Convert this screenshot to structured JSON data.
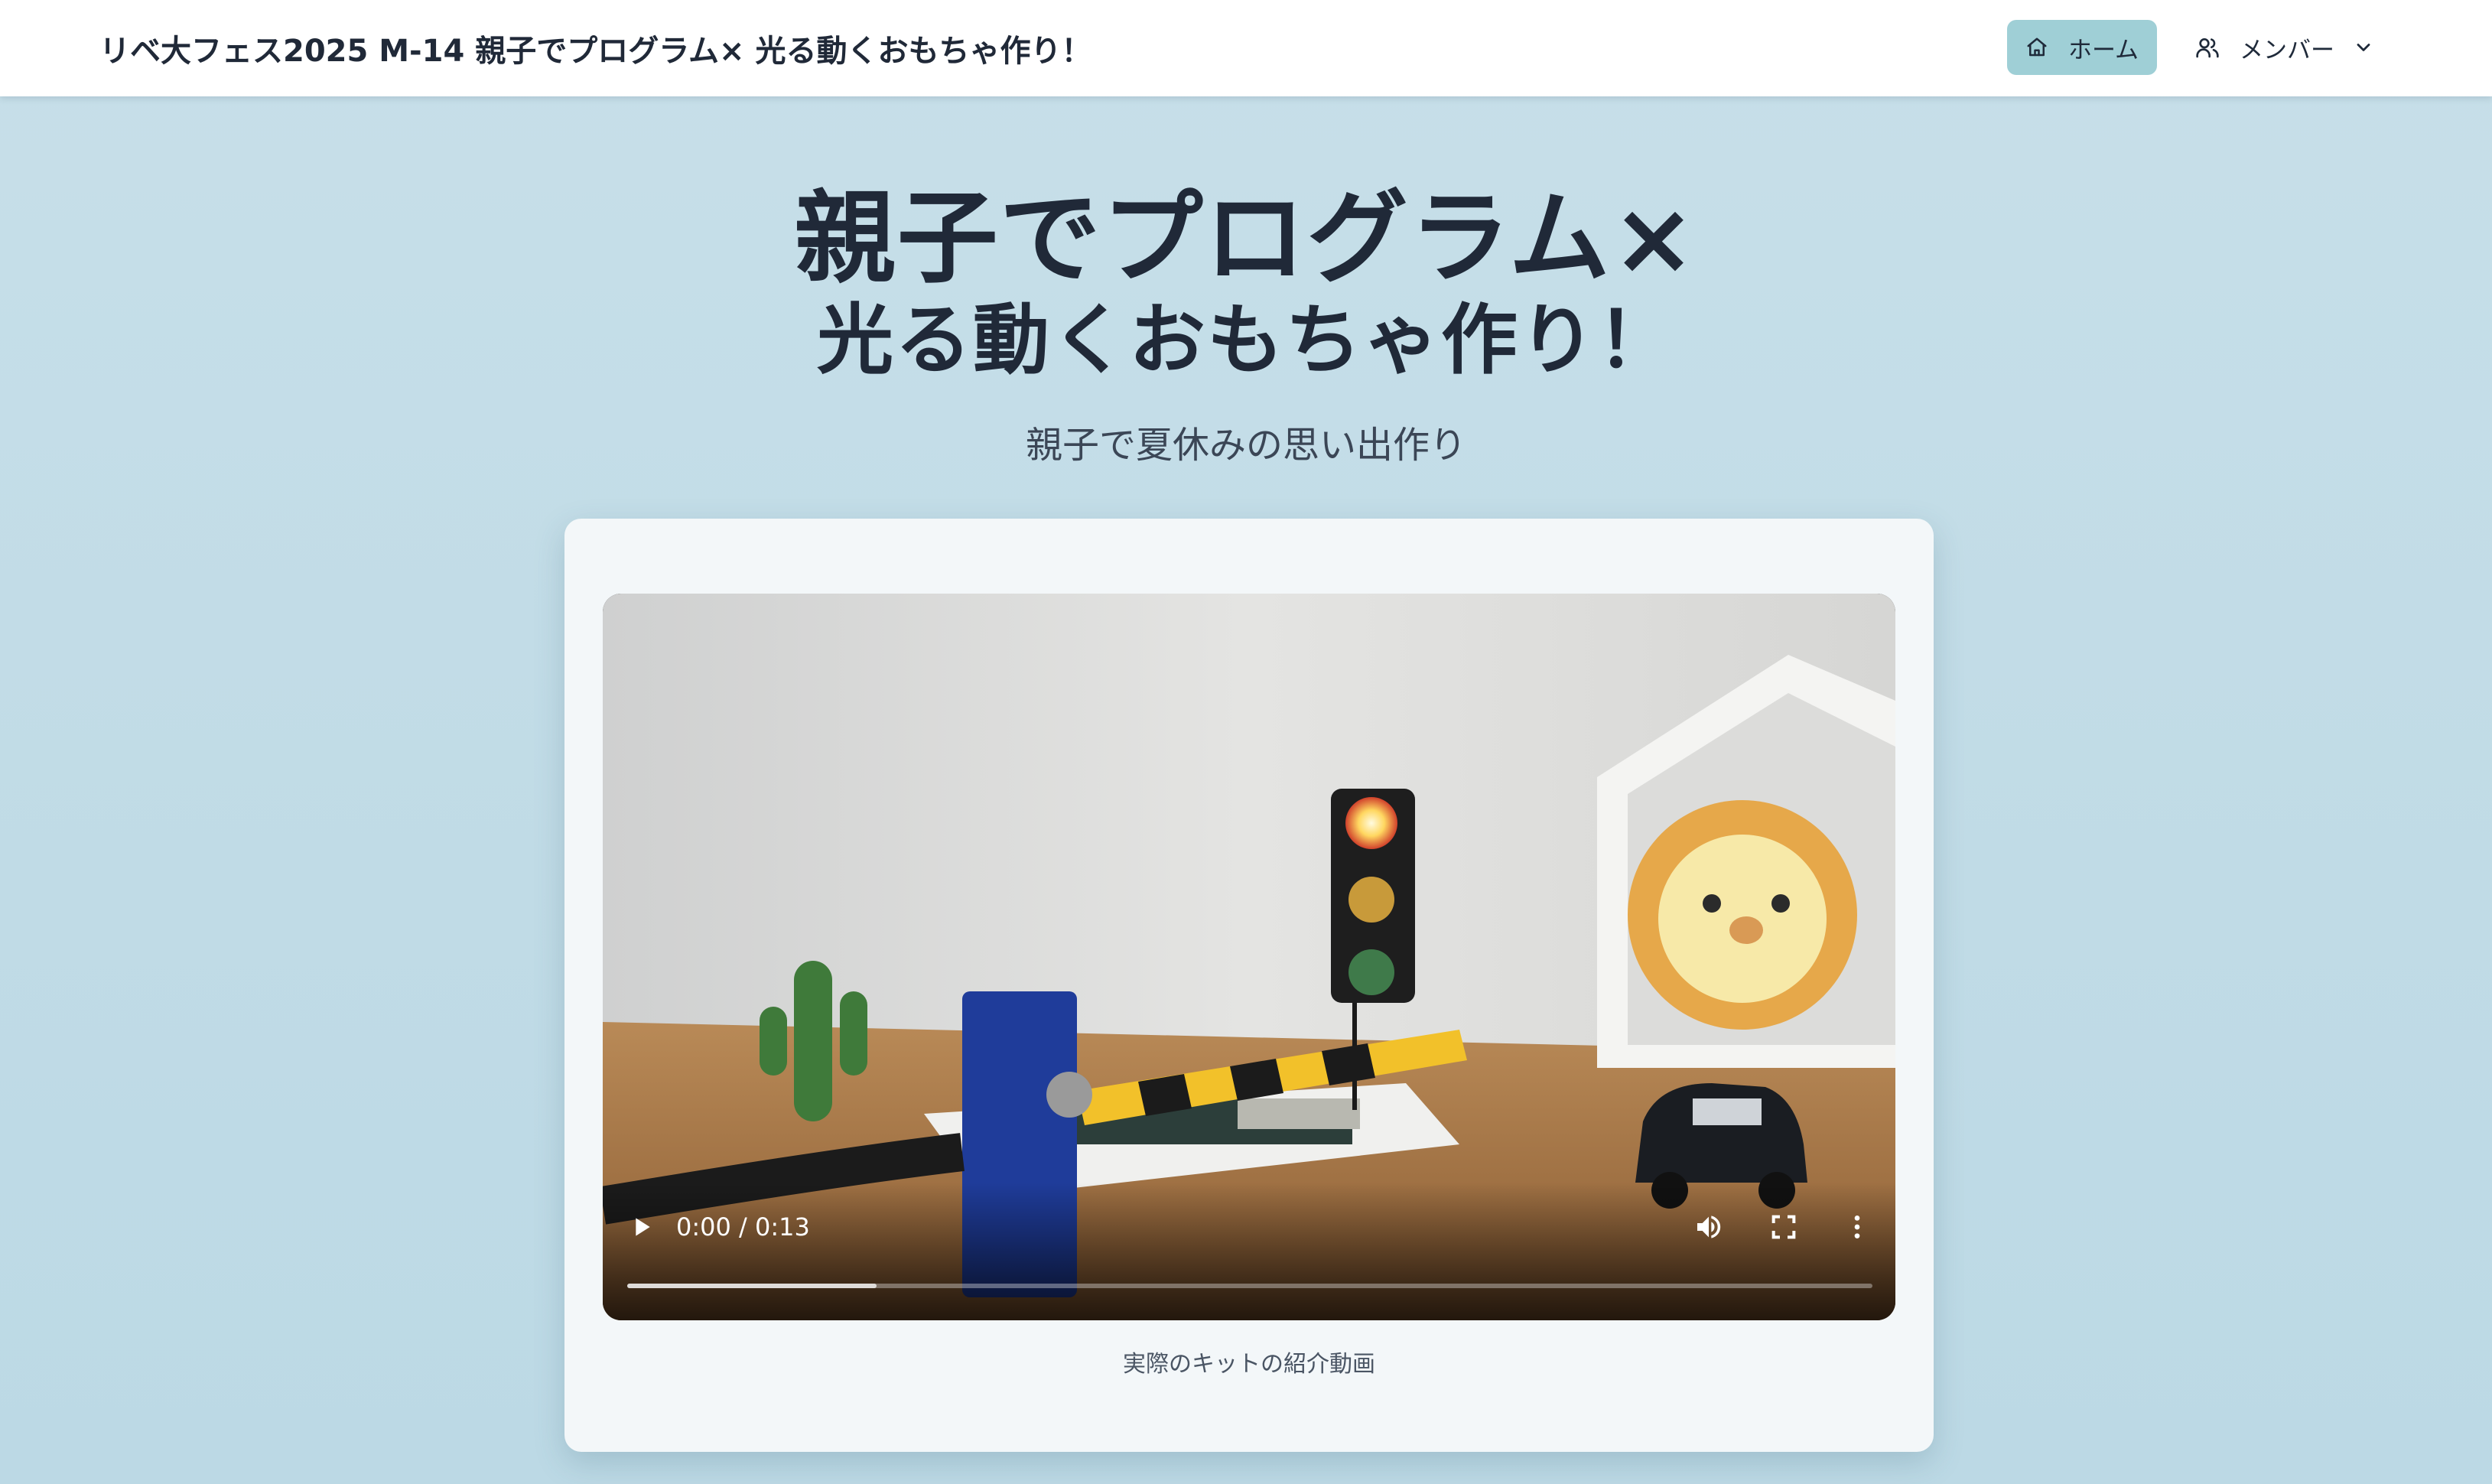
{
  "header": {
    "site_title": "リベ大フェス2025 M-14 親子でプログラム× 光る動くおもちゃ作り！",
    "home_label": "ホーム",
    "member_label": "メンバー"
  },
  "hero": {
    "title_line1": "親子でプログラム×",
    "title_line2": "光る動くおもちゃ作り！",
    "subtitle": "親子で夏休みの思い出作り"
  },
  "video": {
    "time_display": "0:00 / 0:13",
    "buffered_fraction": 0.2,
    "caption": "実際のキットの紹介動画"
  },
  "colors": {
    "page_background": "#c5deea",
    "home_button_bg": "#9fcfd6",
    "text_dark": "#202938"
  },
  "icons": {
    "home": "home-icon",
    "member": "users-icon",
    "dropdown": "chevron-down-icon",
    "play": "play-icon",
    "volume": "volume-icon",
    "fullscreen": "fullscreen-icon",
    "more": "more-vertical-icon"
  }
}
